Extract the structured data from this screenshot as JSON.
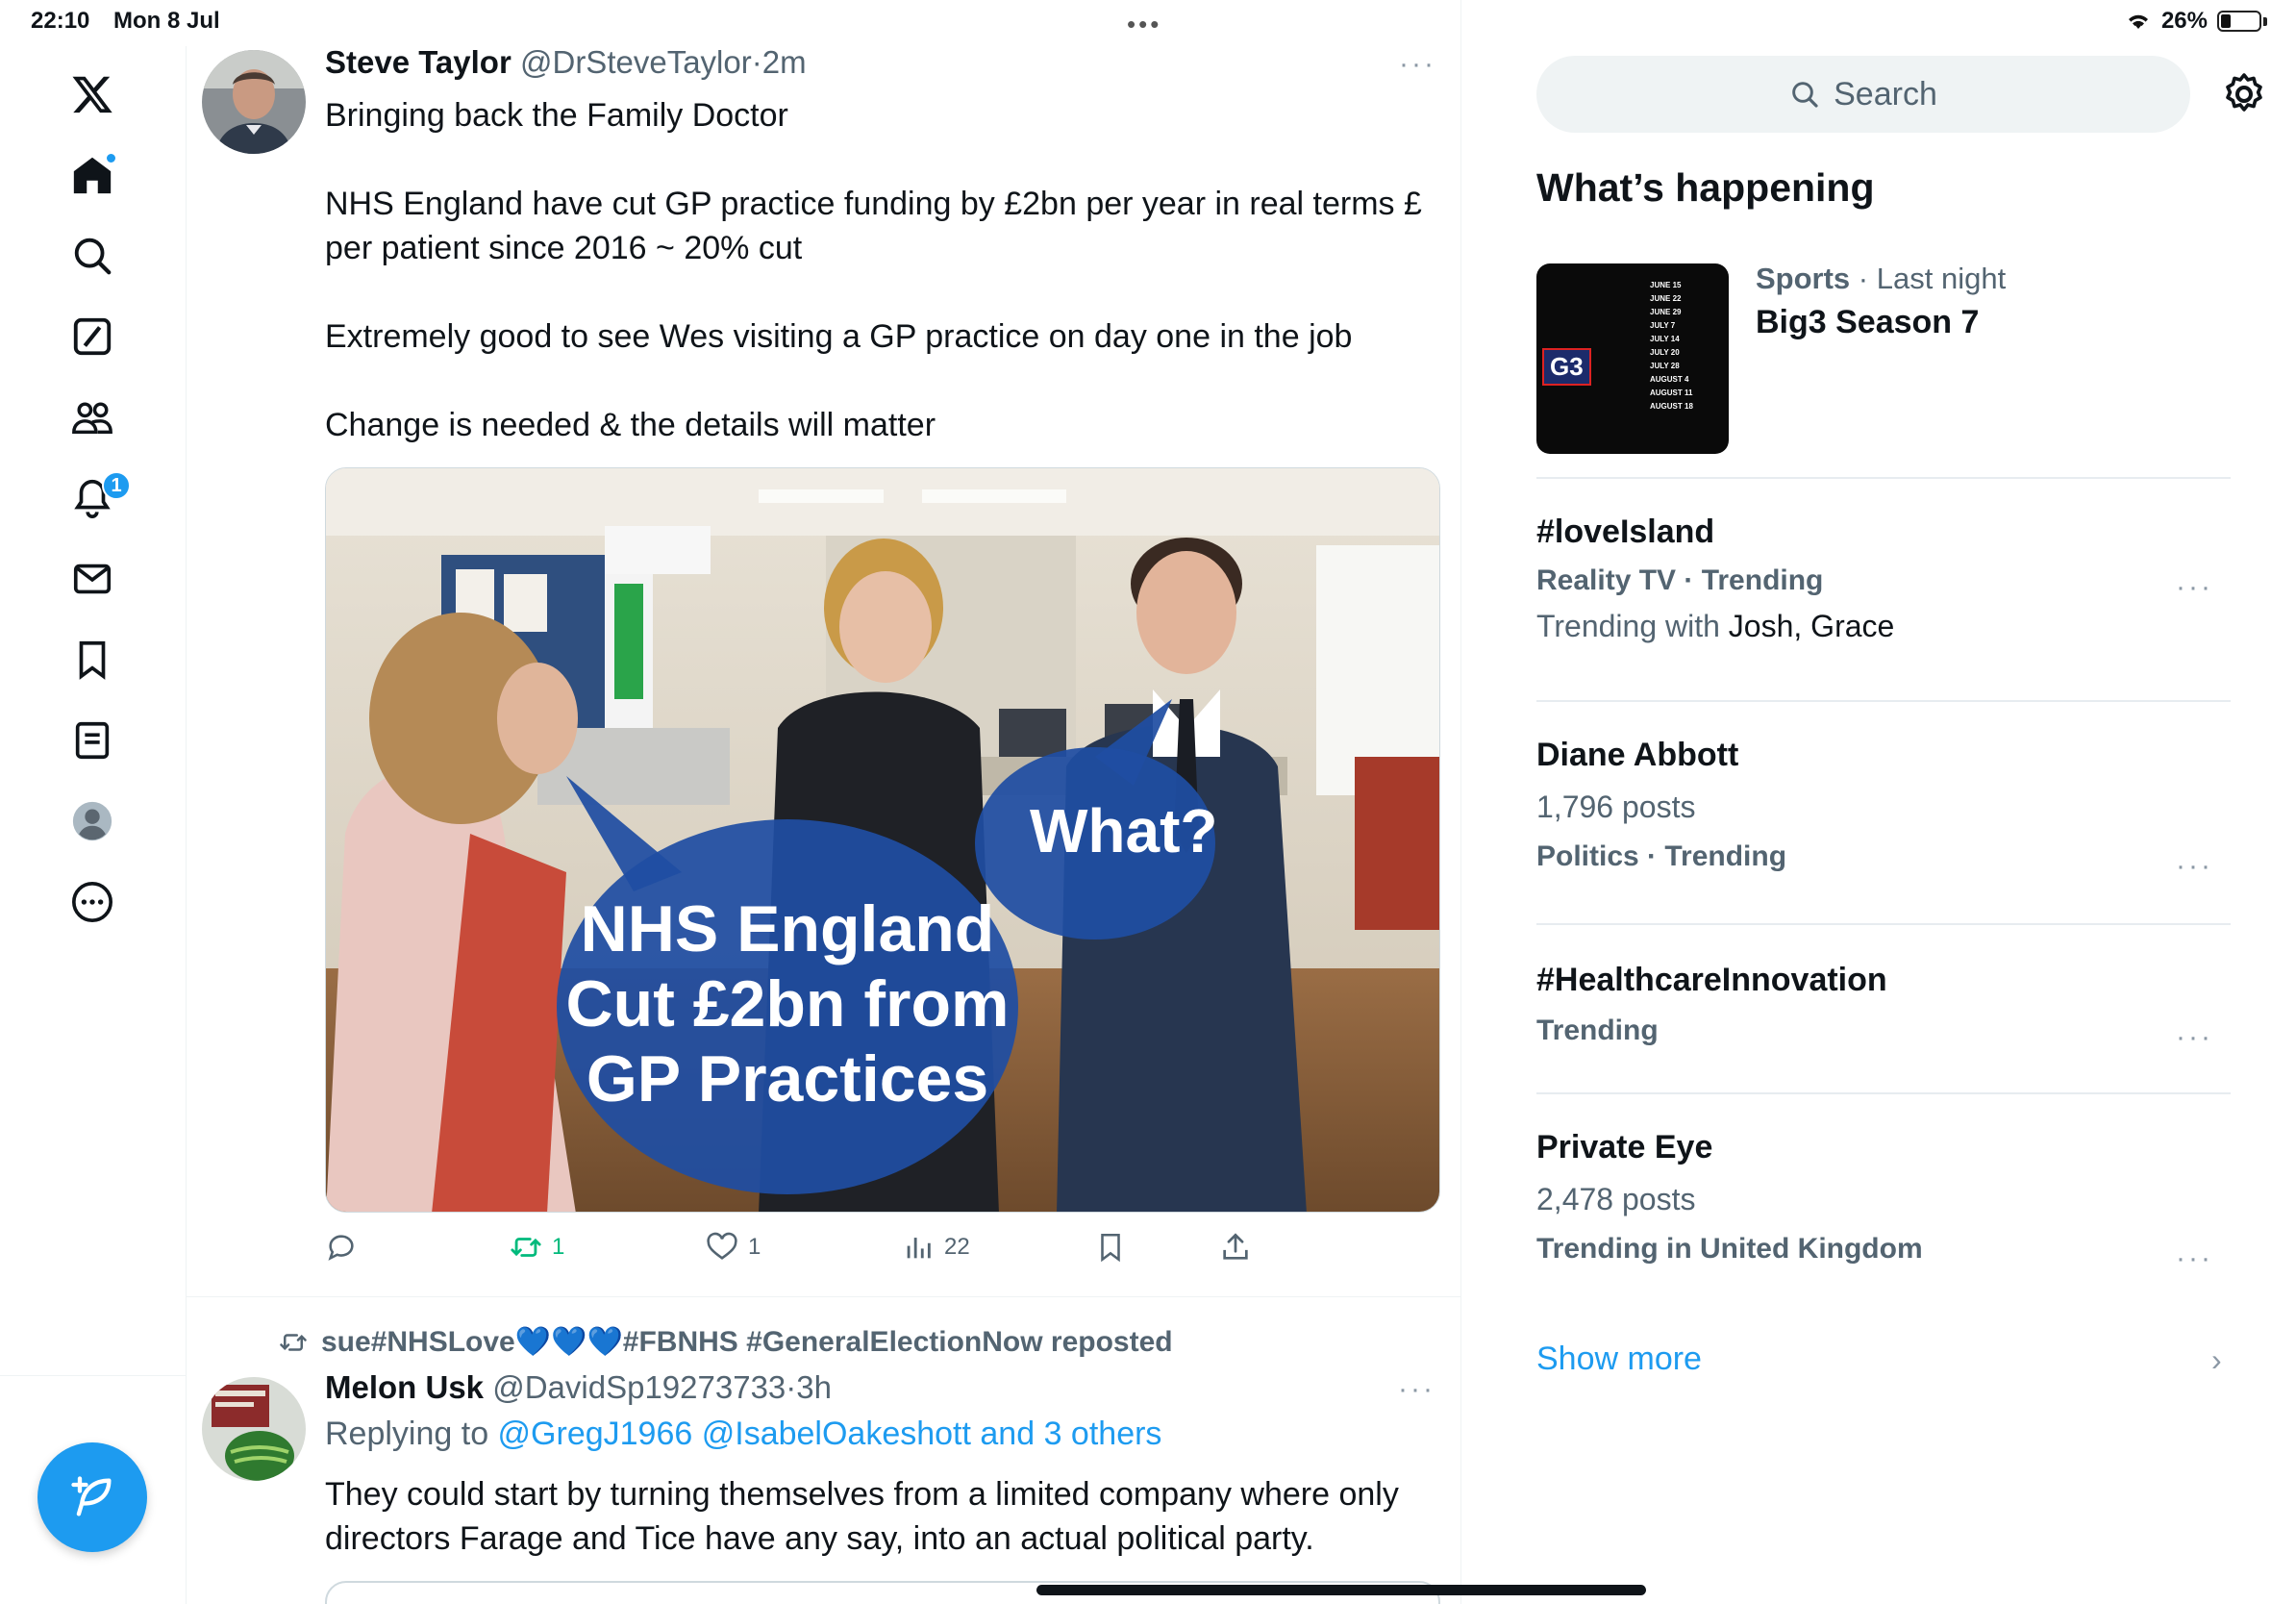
{
  "status_bar": {
    "time": "22:10",
    "date": "Mon 8 Jul",
    "battery": "26%",
    "battery_level": 0.26,
    "multitask_dots": "•••"
  },
  "nav": {
    "items": [
      {
        "name": "x-logo-icon",
        "label": "X"
      },
      {
        "name": "home-icon",
        "label": "Home",
        "has_dot": true
      },
      {
        "name": "search-icon",
        "label": "Explore"
      },
      {
        "name": "grok-icon",
        "label": "Grok"
      },
      {
        "name": "communities-icon",
        "label": "Communities"
      },
      {
        "name": "notifications-icon",
        "label": "Notifications",
        "badge": "1"
      },
      {
        "name": "messages-icon",
        "label": "Messages"
      },
      {
        "name": "bookmarks-icon",
        "label": "Bookmarks"
      },
      {
        "name": "lists-icon",
        "label": "Lists"
      },
      {
        "name": "profile-icon",
        "label": "Profile"
      },
      {
        "name": "more-icon",
        "label": "More"
      }
    ],
    "compose_icon": "compose-feather-icon"
  },
  "tweet1": {
    "author_name": "Steve Taylor",
    "author_handle": "@DrSteveTaylor",
    "separator": "·",
    "time": "2m",
    "more": "···",
    "paragraphs": [
      "Bringing back the Family Doctor",
      "NHS England have cut GP practice funding by £2bn per year in real terms £ per patient since 2016 ~ 20% cut",
      "Extremely good to see Wes visiting a GP practice on day one in the job",
      "Change is needed & the details will matter"
    ],
    "media": {
      "bubble_left": [
        "NHS England",
        "Cut £2bn from",
        "GP Practices"
      ],
      "bubble_right": "What?"
    },
    "actions": {
      "reply_count": "",
      "retweet_count": "1",
      "like_count": "1",
      "views_count": "22",
      "retweeted": true
    }
  },
  "tweet2": {
    "repost_label": "sue#NHSLove💙💙💙#FBNHS #GeneralElectionNow reposted",
    "author_name": "Melon Usk",
    "author_handle": "@DavidSp19273733",
    "separator": "·",
    "time": "3h",
    "more": "···",
    "reply_prefix": "Replying to ",
    "reply_mentions": "@GregJ1966 @IsabelOakeshott and 3 others",
    "text": "They could start by turning themselves from a limited company where only directors Farage and Tice have any say, into an actual political party."
  },
  "sidebar": {
    "search_placeholder": "Search",
    "section_title": "What’s happening",
    "news": {
      "category": "Sports",
      "separator": " · ",
      "time": "Last night",
      "title": "Big3 Season 7",
      "thumb_logo": "G3",
      "thumb_dates": [
        "JUNE 15",
        "JUNE 22",
        "JUNE 29",
        "JULY 7",
        "JULY 14",
        "JULY 20",
        "JULY 28",
        "AUGUST 4",
        "AUGUST 11",
        "AUGUST 18"
      ]
    },
    "trends": [
      {
        "title": "#loveIsland",
        "meta": "Reality TV · Trending",
        "sub_prefix": "Trending with ",
        "sub_names": "Josh, Grace",
        "more": "···"
      },
      {
        "title": "Diane Abbott",
        "posts": "1,796 posts",
        "meta": "Politics · Trending",
        "more": "···"
      },
      {
        "title": "#HealthcareInnovation",
        "meta": "Trending",
        "more": "···"
      },
      {
        "title": "Private Eye",
        "posts": "2,478 posts",
        "meta": "Trending in United Kingdom",
        "more": "···"
      }
    ],
    "show_more": "Show more",
    "show_more_chevron": "›"
  },
  "colors": {
    "accent": "#1d9bf0",
    "retweet_green": "#00ba7c",
    "secondary_text": "#536471",
    "bubble_blue": "#1f4ea3"
  }
}
